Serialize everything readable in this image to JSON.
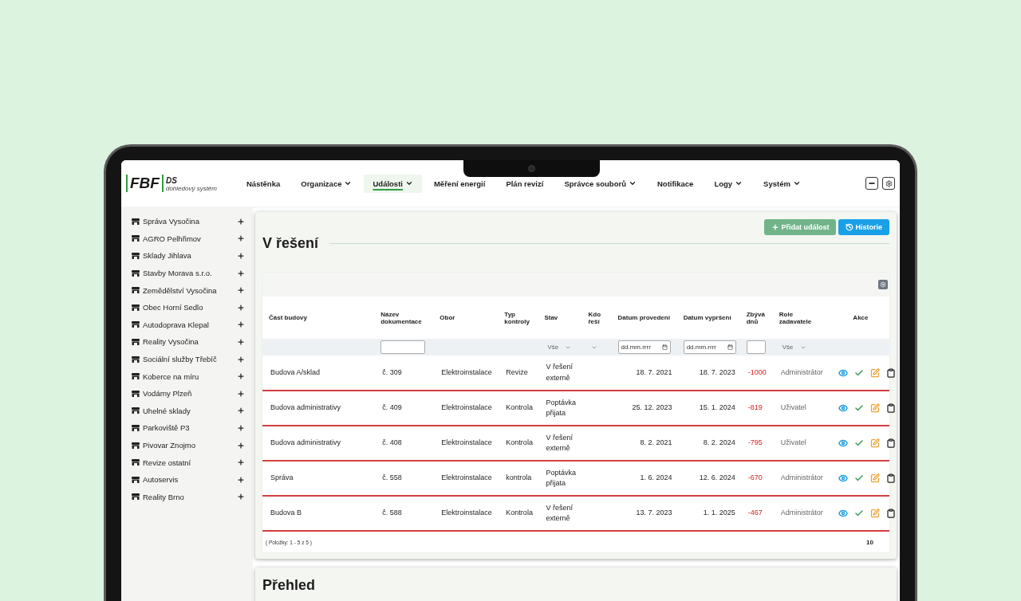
{
  "logo": {
    "mark": "FBF",
    "name": "DS",
    "tagline": "dohledový systém"
  },
  "nav": [
    {
      "label": "Nástěnka",
      "dropdown": false,
      "selected": false
    },
    {
      "label": "Organizace",
      "dropdown": true,
      "selected": false
    },
    {
      "label": "Události",
      "dropdown": true,
      "selected": true
    },
    {
      "label": "Měření energií",
      "dropdown": false,
      "selected": false
    },
    {
      "label": "Plán revizí",
      "dropdown": false,
      "selected": false
    },
    {
      "label": "Správce souborů",
      "dropdown": true,
      "selected": false
    },
    {
      "label": "Notifikace",
      "dropdown": false,
      "selected": false
    },
    {
      "label": "Logy",
      "dropdown": true,
      "selected": false
    },
    {
      "label": "Systém",
      "dropdown": true,
      "selected": false
    }
  ],
  "sidebar": {
    "items": [
      {
        "label": "Správa Vysočina"
      },
      {
        "label": "AGRO Pelhřimov"
      },
      {
        "label": "Sklady Jihlava"
      },
      {
        "label": "Stavby Morava s.r.o."
      },
      {
        "label": "Zemědělství Vysočina"
      },
      {
        "label": "Obec Horní Sedlo"
      },
      {
        "label": "Autodoprava Klepal"
      },
      {
        "label": "Reality Vysočina"
      },
      {
        "label": "Sociální služby Třebíč"
      },
      {
        "label": "Koberce na míru"
      },
      {
        "label": "Vodárny Plzeň"
      },
      {
        "label": "Uhelné sklady"
      },
      {
        "label": "Parkoviště P3"
      },
      {
        "label": "Pivovar Znojmo"
      },
      {
        "label": "Revize ostatní"
      },
      {
        "label": "Autoservis"
      },
      {
        "label": "Reality Brno"
      }
    ]
  },
  "section": {
    "title": "V řešení",
    "buttons": [
      {
        "label": "Přidat událost",
        "kind": "add"
      },
      {
        "label": "Historie",
        "kind": "history"
      }
    ]
  },
  "table": {
    "columns": [
      "Část budovy",
      "Název dokumentace",
      "Obor",
      "Typ kontroly",
      "Stav",
      "Kdo řeší",
      "Datum provedení",
      "Datum vypršení",
      "Zbývá dnů",
      "Role zadavatele",
      "Akce"
    ],
    "filters": [
      {
        "kind": "none"
      },
      {
        "kind": "text"
      },
      {
        "kind": "none"
      },
      {
        "kind": "none"
      },
      {
        "kind": "select",
        "value": "Vše"
      },
      {
        "kind": "select"
      },
      {
        "kind": "date",
        "placeholder": "dd.mm.rrrr"
      },
      {
        "kind": "date",
        "placeholder": "dd.mm.rrrr"
      },
      {
        "kind": "text"
      },
      {
        "kind": "select",
        "value": "Vše"
      },
      {
        "kind": "none"
      }
    ],
    "rows": [
      {
        "cells": [
          "Budova A/sklad",
          "č. 309",
          "Elektroinstalace",
          "Revize",
          "V řešení externě",
          "",
          "18. 7. 2021",
          "18. 7. 2023",
          "-1000",
          "Administrátor"
        ]
      },
      {
        "cells": [
          "Budova administrativy",
          "č. 409",
          "Elektroinstalace",
          "Kontrola",
          "Poptávka přijata",
          "",
          "25. 12. 2023",
          "15. 1. 2024",
          "-819",
          "Uživatel"
        ]
      },
      {
        "cells": [
          "Budova administrativy",
          "č. 408",
          "Elektroinstalace",
          "Kontrola",
          "V řešení externě",
          "",
          "8. 2. 2021",
          "8. 2. 2024",
          "-795",
          "Uživatel"
        ]
      },
      {
        "cells": [
          "Správa",
          "č. 558",
          "Elektroinstalace",
          "kontrola",
          "Poptávka přijata",
          "",
          "1. 6. 2024",
          "12. 6. 2024",
          "-670",
          "Administrátor"
        ]
      },
      {
        "cells": [
          "Budova B",
          "č. 588",
          "Elektroinstalace",
          "Kontrola",
          "V řešení externě",
          "",
          "13. 7. 2023",
          "1. 1. 2025",
          "-467",
          "Administrátor"
        ]
      }
    ],
    "footer": {
      "summary": "( Položky: 1 - 5 z 5 )",
      "page_size": "10"
    }
  },
  "next_section": {
    "title": "Přehled"
  }
}
